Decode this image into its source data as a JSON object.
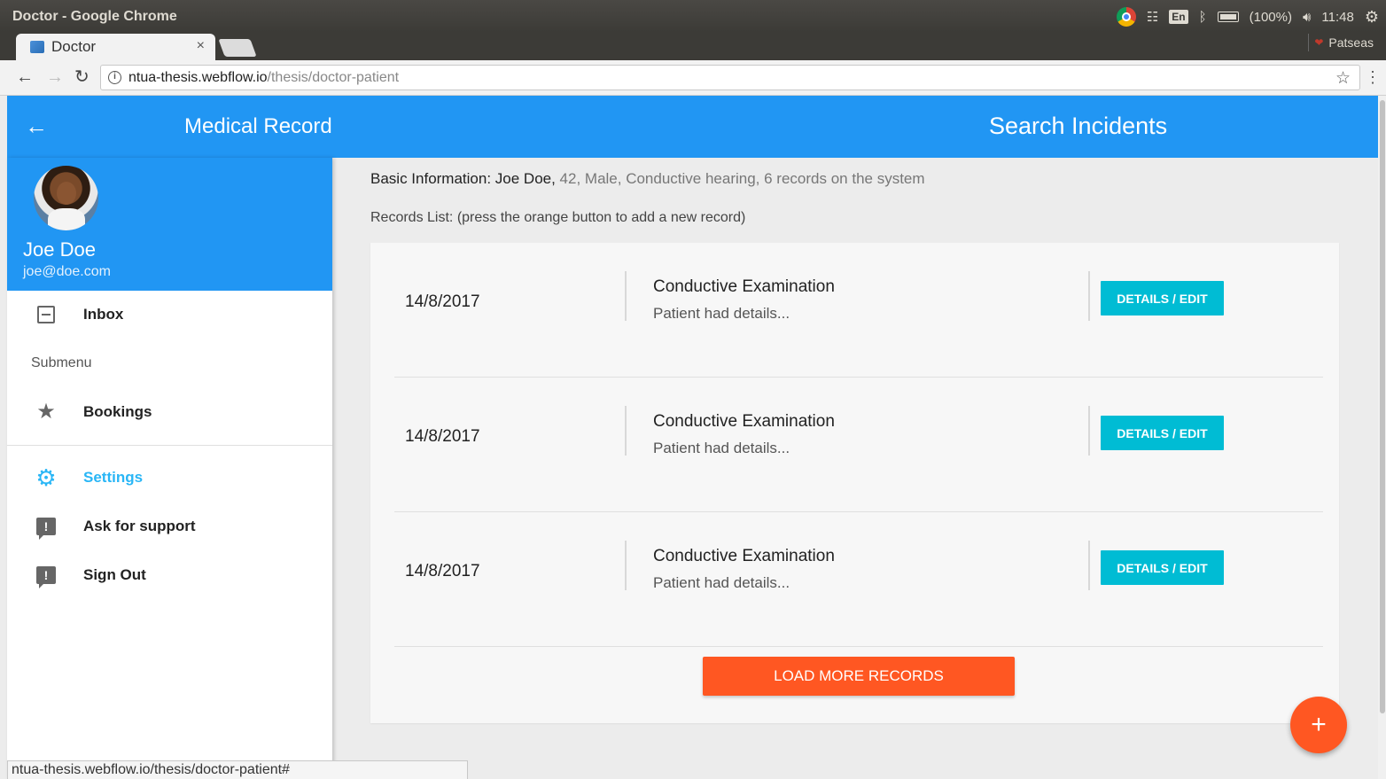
{
  "os": {
    "window_title": "Doctor - Google Chrome",
    "language": "En",
    "battery": "(100%)",
    "time": "11:48",
    "profile_name": "Patseas"
  },
  "browser": {
    "tab_title": "Doctor",
    "tab_close": "×",
    "url_host": "ntua-thesis.webflow.io",
    "url_path": "/thesis/doctor-patient",
    "status_url": "ntua-thesis.webflow.io/thesis/doctor-patient#"
  },
  "header": {
    "back": "←",
    "title": "Medical Record",
    "search": "Search Incidents"
  },
  "drawer": {
    "user_name": "Joe Doe",
    "user_email": "joe@doe.com",
    "subheader": "Submenu",
    "items": [
      {
        "label": "Inbox",
        "icon": "inbox-icon"
      },
      {
        "label": "Bookings",
        "icon": "star-icon"
      },
      {
        "label": "Settings",
        "icon": "gear-icon"
      },
      {
        "label": "Ask for support",
        "icon": "feedback-icon"
      },
      {
        "label": "Sign Out",
        "icon": "feedback-icon"
      }
    ]
  },
  "main": {
    "basic_label": "Basic Information: Joe Doe,",
    "basic_rest": " 42, Male, Conductive hearing, 6 records on the system",
    "records_hint": "Records List: (press the orange button to add a new record)",
    "records": [
      {
        "date": "14/8/2017",
        "title": "Conductive Examination",
        "desc": "Patient had details...",
        "button": "DETAILS / EDIT"
      },
      {
        "date": "14/8/2017",
        "title": "Conductive Examination",
        "desc": "Patient had details...",
        "button": "DETAILS / EDIT"
      },
      {
        "date": "14/8/2017",
        "title": "Conductive Examination",
        "desc": "Patient had details...",
        "button": "DETAILS / EDIT"
      }
    ],
    "load_more": "LOAD MORE RECORDS",
    "fab": "+"
  },
  "colors": {
    "primary": "#2196f3",
    "accent": "#ff5722",
    "button": "#00bcd4",
    "settings": "#29b6f6"
  }
}
